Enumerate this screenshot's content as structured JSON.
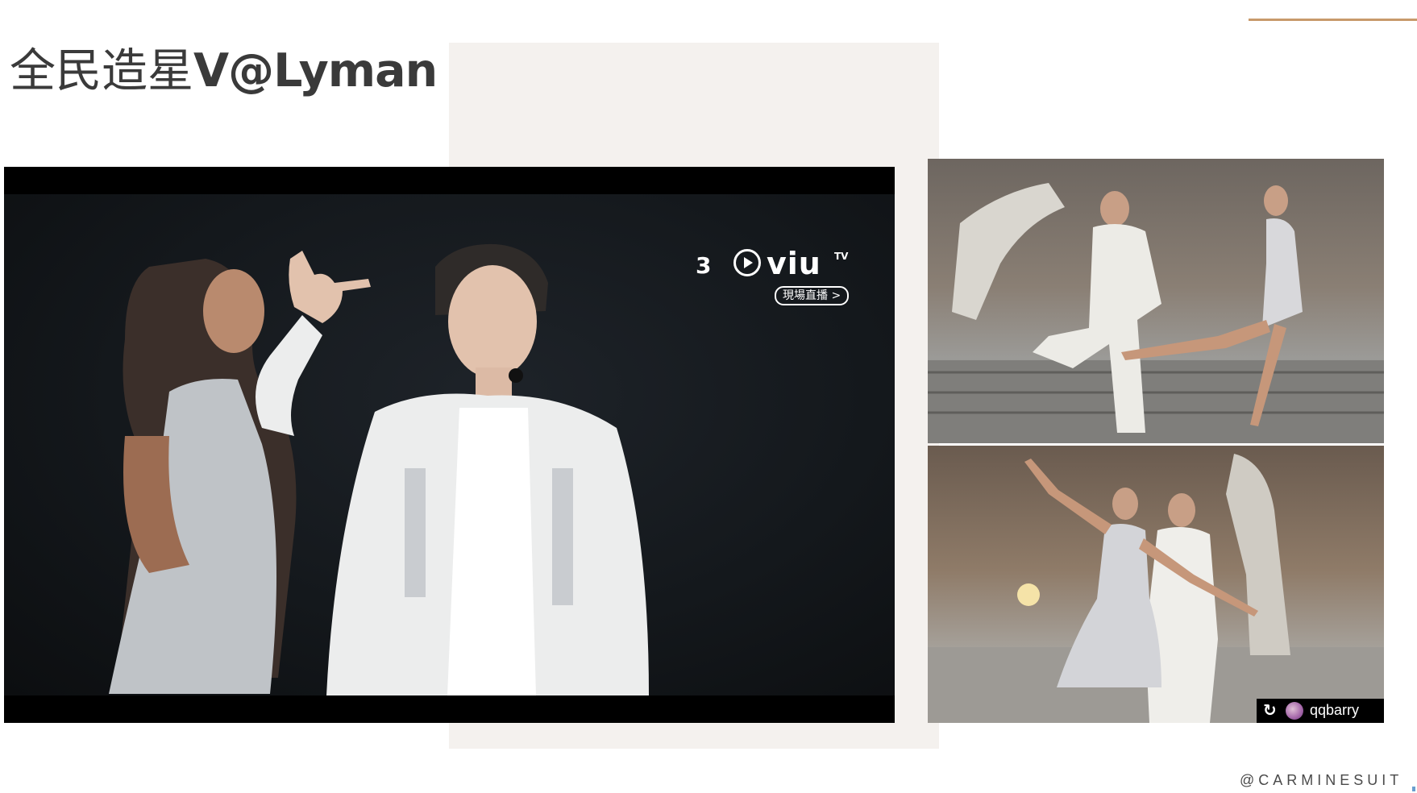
{
  "slide": {
    "title_cn": "全民造星",
    "title_en": "V@Lyman"
  },
  "video": {
    "channel": "3",
    "brand": "viu",
    "brand_suffix": "TV",
    "live_badge": "現場直播 >"
  },
  "photo_credit": {
    "repost_icon": "↻",
    "username": "qqbarry"
  },
  "footer": {
    "handle": "@CARMINESUIT"
  },
  "colors": {
    "accent_line": "#c89a6b",
    "panel_beige": "#f4f1ee",
    "title_text": "#3a3a3a"
  }
}
